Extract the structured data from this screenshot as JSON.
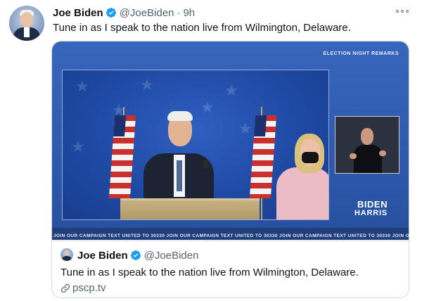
{
  "tweet": {
    "author_name": "Joe Biden",
    "handle": "@JoeBiden",
    "separator": "·",
    "time": "9h",
    "text": "Tune in as I speak to the nation live from Wilmington, Delaware."
  },
  "video": {
    "eyebrow": "ELECTION NIGHT REMARKS",
    "logo_line1": "BIDEN",
    "logo_line2": "HARRIS",
    "ticker": "JOIN OUR CAMPAIGN   TEXT UNITED TO 30330   JOIN OUR CAMPAIGN   TEXT UNITED TO 30330   JOIN OUR CAMPAIGN   TEXT UNITED TO 30330   JOIN OUR CAMPAIGN   TEXT UNIT"
  },
  "quote": {
    "author_name": "Joe Biden",
    "handle": "@JoeBiden",
    "text": "Tune in as I speak to the nation live from Wilmington, Delaware.",
    "link": "pscp.tv"
  },
  "colors": {
    "verified": "#1d9bf0",
    "muted": "#536471",
    "video_blue": "#2c56a8"
  },
  "icons": [
    "verified-badge-icon",
    "more-options-icon",
    "link-icon"
  ]
}
